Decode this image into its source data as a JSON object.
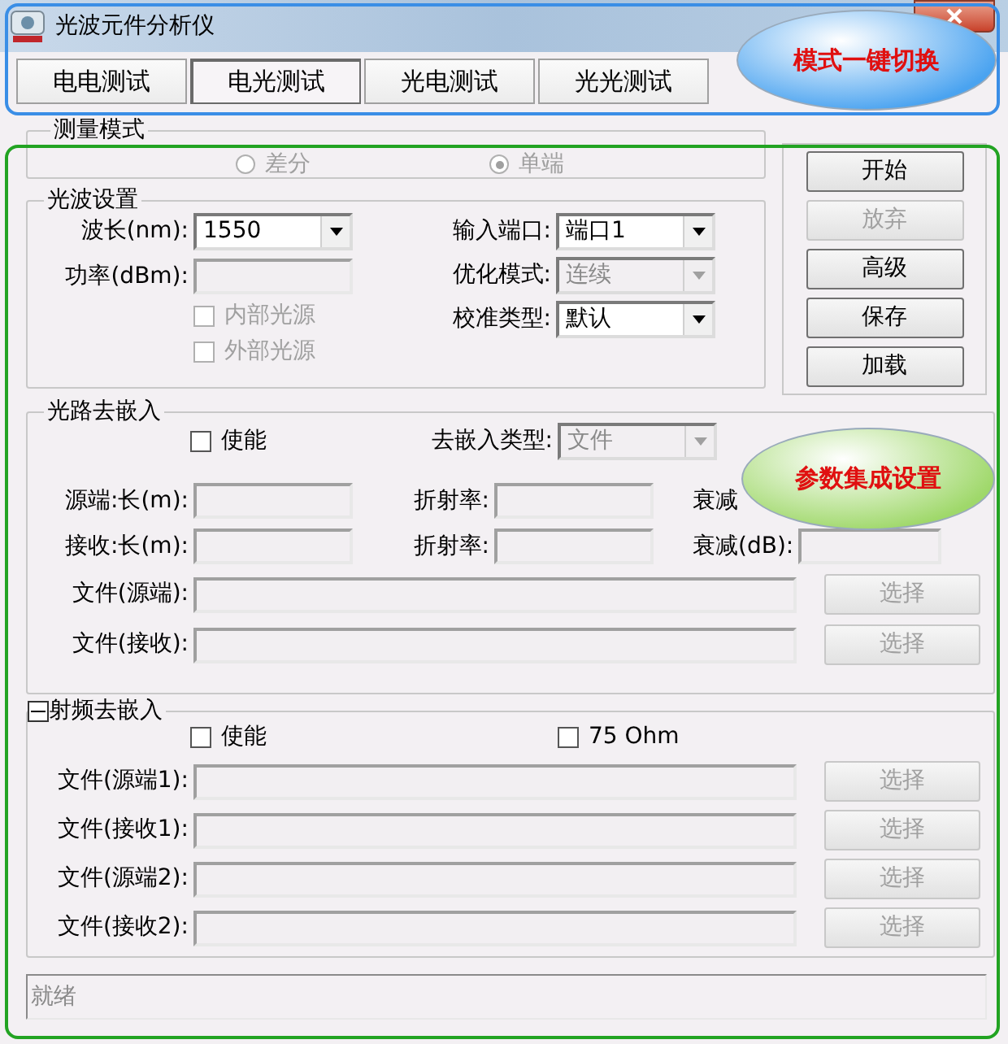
{
  "window": {
    "title": "光波元件分析仪"
  },
  "tabs": [
    {
      "label": "电电测试",
      "selected": false
    },
    {
      "label": "电光测试",
      "selected": true
    },
    {
      "label": "光电测试",
      "selected": false
    },
    {
      "label": "光光测试",
      "selected": false
    }
  ],
  "measure_mode": {
    "title": "测量模式",
    "disabled": true,
    "options": [
      {
        "label": "差分",
        "selected": false
      },
      {
        "label": "单端",
        "selected": true
      }
    ]
  },
  "light_settings": {
    "title": "光波设置",
    "left": [
      {
        "kind": "combo",
        "label": "波长(nm):",
        "value": "1550",
        "disabled": false
      },
      {
        "kind": "field",
        "label": "功率(dBm):",
        "disabled": true
      }
    ],
    "checkboxes": [
      {
        "label": "内部光源",
        "checked": false,
        "disabled": true
      },
      {
        "label": "外部光源",
        "checked": false,
        "disabled": true
      }
    ],
    "right": [
      {
        "kind": "combo",
        "label": "输入端口:",
        "value": "端口1",
        "disabled": false
      },
      {
        "kind": "combo",
        "label": "优化模式:",
        "value": "连续",
        "disabled": true
      },
      {
        "kind": "combo",
        "label": "校准类型:",
        "value": "默认",
        "disabled": false
      }
    ]
  },
  "actions": [
    {
      "label": "开始",
      "disabled": false
    },
    {
      "label": "放弃",
      "disabled": true
    },
    {
      "label": "高级",
      "disabled": false
    },
    {
      "label": "保存",
      "disabled": false
    },
    {
      "label": "加载",
      "disabled": false
    }
  ],
  "optical_deembed": {
    "title": "光路去嵌入",
    "enable": {
      "label": "使能",
      "checked": false
    },
    "type": {
      "label": "去嵌入类型:",
      "value": "文件",
      "disabled": true
    },
    "rows": [
      [
        {
          "kind": "field",
          "label": "源端:长(m):"
        },
        {
          "kind": "field",
          "label": "折射率:"
        },
        {
          "kind": "label",
          "label": "衰减"
        }
      ],
      [
        {
          "kind": "field",
          "label": "接收:长(m):"
        },
        {
          "kind": "field",
          "label": "折射率:"
        },
        {
          "kind": "field",
          "label": "衰减(dB):"
        }
      ]
    ],
    "files": [
      {
        "label": "文件(源端):",
        "button": "选择",
        "disabled": true
      },
      {
        "label": "文件(接收):",
        "button": "选择",
        "disabled": true
      }
    ]
  },
  "rf_deembed": {
    "title": "射频去嵌入",
    "expanded": true,
    "checkboxes": [
      {
        "label": "使能",
        "checked": false
      },
      {
        "label": "75 Ohm",
        "checked": false
      }
    ],
    "files": [
      {
        "label": "文件(源端1):",
        "button": "选择",
        "disabled": true
      },
      {
        "label": "文件(接收1):",
        "button": "选择",
        "disabled": true
      },
      {
        "label": "文件(源端2):",
        "button": "选择",
        "disabled": true
      },
      {
        "label": "文件(接收2):",
        "button": "选择",
        "disabled": true
      }
    ]
  },
  "status_bar": {
    "text": "就绪"
  },
  "annotations": [
    {
      "kind": "frame",
      "color": "#3a8ee6"
    },
    {
      "kind": "frame",
      "color": "#22a322"
    },
    {
      "kind": "callout",
      "text": "模式一键切换",
      "color": "#4aa3f0"
    },
    {
      "kind": "callout",
      "text": "参数集成设置",
      "color": "#9fd86a"
    }
  ]
}
